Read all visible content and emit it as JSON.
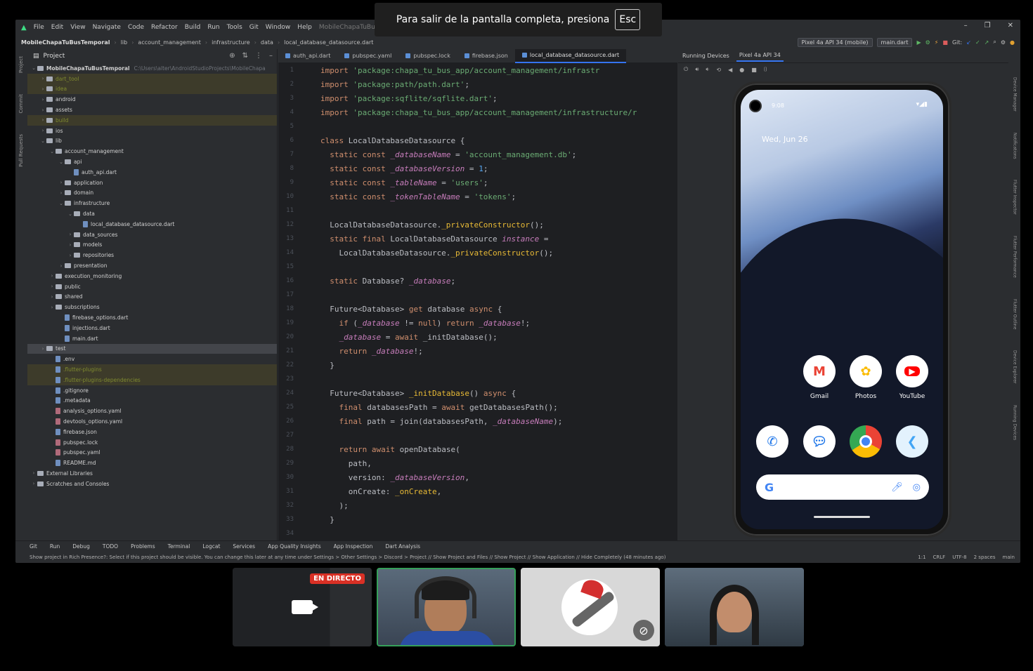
{
  "banner": {
    "text": "Para salir de la pantalla completa, presiona",
    "key": "Esc"
  },
  "menu": [
    "File",
    "Edit",
    "View",
    "Navigate",
    "Code",
    "Refactor",
    "Build",
    "Run",
    "Tools",
    "Git",
    "Window",
    "Help"
  ],
  "window_title": "MobileChapaTuBusTemporal",
  "breadcrumb": [
    "MobileChapaTuBusTemporal",
    "lib",
    "account_management",
    "infrastructure",
    "data",
    "local_database_datasource.dart"
  ],
  "toolbar": {
    "device": "Pixel 4a API 34 (mobile)",
    "run_config": "main.dart",
    "git": "Git:"
  },
  "project_panel": {
    "title": "Project",
    "root": "MobileChapaTuBusTemporal",
    "root_path": "C:\\Users\\alter\\AndroidStudioProjects\\MobileChapa",
    "tree": [
      {
        "label": "dart_tool",
        "level": 1,
        "type": "folder",
        "ignored": true
      },
      {
        "label": "idea",
        "level": 1,
        "type": "folder",
        "ignored": true
      },
      {
        "label": "android",
        "level": 1,
        "type": "folder"
      },
      {
        "label": "assets",
        "level": 1,
        "type": "folder"
      },
      {
        "label": "build",
        "level": 1,
        "type": "folder",
        "ignored": true
      },
      {
        "label": "ios",
        "level": 1,
        "type": "folder"
      },
      {
        "label": "lib",
        "level": 1,
        "type": "folder",
        "open": true
      },
      {
        "label": "account_management",
        "level": 2,
        "type": "folder",
        "open": true
      },
      {
        "label": "api",
        "level": 3,
        "type": "folder",
        "open": true
      },
      {
        "label": "auth_api.dart",
        "level": 4,
        "type": "file"
      },
      {
        "label": "application",
        "level": 3,
        "type": "folder"
      },
      {
        "label": "domain",
        "level": 3,
        "type": "folder"
      },
      {
        "label": "infrastructure",
        "level": 3,
        "type": "folder",
        "open": true
      },
      {
        "label": "data",
        "level": 4,
        "type": "folder",
        "open": true
      },
      {
        "label": "local_database_datasource.dart",
        "level": 5,
        "type": "file"
      },
      {
        "label": "data_sources",
        "level": 4,
        "type": "folder"
      },
      {
        "label": "models",
        "level": 4,
        "type": "folder"
      },
      {
        "label": "repositories",
        "level": 4,
        "type": "folder"
      },
      {
        "label": "presentation",
        "level": 3,
        "type": "folder"
      },
      {
        "label": "execution_monitoring",
        "level": 2,
        "type": "folder"
      },
      {
        "label": "public",
        "level": 2,
        "type": "folder"
      },
      {
        "label": "shared",
        "level": 2,
        "type": "folder"
      },
      {
        "label": "subscriptions",
        "level": 2,
        "type": "folder"
      },
      {
        "label": "firebase_options.dart",
        "level": 3,
        "type": "file"
      },
      {
        "label": "injections.dart",
        "level": 3,
        "type": "file"
      },
      {
        "label": "main.dart",
        "level": 3,
        "type": "file"
      },
      {
        "label": "test",
        "level": 1,
        "type": "folder",
        "selected": true
      },
      {
        "label": ".env",
        "level": 2,
        "type": "file"
      },
      {
        "label": ".flutter-plugins",
        "level": 2,
        "type": "file",
        "ignored": true
      },
      {
        "label": ".flutter-plugins-dependencies",
        "level": 2,
        "type": "file",
        "ignored": true
      },
      {
        "label": ".gitignore",
        "level": 2,
        "type": "file"
      },
      {
        "label": ".metadata",
        "level": 2,
        "type": "file"
      },
      {
        "label": "analysis_options.yaml",
        "level": 2,
        "type": "file",
        "yml": true
      },
      {
        "label": "devtools_options.yaml",
        "level": 2,
        "type": "file",
        "yml": true
      },
      {
        "label": "firebase.json",
        "level": 2,
        "type": "file"
      },
      {
        "label": "pubspec.lock",
        "level": 2,
        "type": "file",
        "yml": true
      },
      {
        "label": "pubspec.yaml",
        "level": 2,
        "type": "file",
        "yml": true
      },
      {
        "label": "README.md",
        "level": 2,
        "type": "file"
      },
      {
        "label": "External Libraries",
        "level": 0,
        "type": "folder"
      },
      {
        "label": "Scratches and Consoles",
        "level": 0,
        "type": "folder"
      }
    ]
  },
  "editor_tabs": [
    "auth_api.dart",
    "pubspec.yaml",
    "pubspec.lock",
    "firebase.json",
    "local_database_datasource.dart"
  ],
  "code_lines": [
    [
      [
        "kw",
        "import "
      ],
      [
        "str",
        "'package:chapa_tu_bus_app/account_management/infrastr"
      ]
    ],
    [
      [
        "kw",
        "import "
      ],
      [
        "str",
        "'package:path/path.dart'"
      ],
      [
        "plain",
        ";"
      ]
    ],
    [
      [
        "kw",
        "import "
      ],
      [
        "str",
        "'package:sqflite/sqflite.dart'"
      ],
      [
        "plain",
        ";"
      ]
    ],
    [
      [
        "kw",
        "import "
      ],
      [
        "str",
        "'package:chapa_tu_bus_app/account_management/infrastructure/r"
      ]
    ],
    [],
    [
      [
        "kw",
        "class "
      ],
      [
        "cls",
        "LocalDatabaseDatasource {"
      ]
    ],
    [
      [
        "plain",
        "  "
      ],
      [
        "kw",
        "static const "
      ],
      [
        "fld",
        "_databaseName"
      ],
      [
        "plain",
        " = "
      ],
      [
        "str",
        "'account_management.db'"
      ],
      [
        "plain",
        ";"
      ]
    ],
    [
      [
        "plain",
        "  "
      ],
      [
        "kw",
        "static const "
      ],
      [
        "fld",
        "_databaseVersion"
      ],
      [
        "plain",
        " = "
      ],
      [
        "fn",
        "1"
      ],
      [
        "plain",
        ";"
      ]
    ],
    [
      [
        "plain",
        "  "
      ],
      [
        "kw",
        "static const "
      ],
      [
        "fld",
        "_tableName"
      ],
      [
        "plain",
        " = "
      ],
      [
        "str",
        "'users'"
      ],
      [
        "plain",
        ";"
      ]
    ],
    [
      [
        "plain",
        "  "
      ],
      [
        "kw",
        "static const "
      ],
      [
        "fld",
        "_tokenTableName"
      ],
      [
        "plain",
        " = "
      ],
      [
        "str",
        "'tokens'"
      ],
      [
        "plain",
        ";"
      ]
    ],
    [],
    [
      [
        "plain",
        "  LocalDatabaseDatasource."
      ],
      [
        "fn2",
        "_privateConstructor"
      ],
      [
        "plain",
        "();"
      ]
    ],
    [
      [
        "plain",
        "  "
      ],
      [
        "kw",
        "static final "
      ],
      [
        "plain",
        "LocalDatabaseDatasource "
      ],
      [
        "fld",
        "instance"
      ],
      [
        "plain",
        " ="
      ]
    ],
    [
      [
        "plain",
        "    LocalDatabaseDatasource."
      ],
      [
        "fn2",
        "_privateConstructor"
      ],
      [
        "plain",
        "();"
      ]
    ],
    [],
    [
      [
        "plain",
        "  "
      ],
      [
        "kw",
        "static "
      ],
      [
        "plain",
        "Database? "
      ],
      [
        "fld",
        "_database"
      ],
      [
        "plain",
        ";"
      ]
    ],
    [],
    [
      [
        "plain",
        "  Future<Database> "
      ],
      [
        "kw",
        "get "
      ],
      [
        "plain",
        "database "
      ],
      [
        "kw",
        "async "
      ],
      [
        "plain",
        "{"
      ]
    ],
    [
      [
        "plain",
        "    "
      ],
      [
        "kw",
        "if "
      ],
      [
        "plain",
        "("
      ],
      [
        "fld",
        "_database"
      ],
      [
        "plain",
        " != "
      ],
      [
        "kw",
        "null"
      ],
      [
        "plain",
        ") "
      ],
      [
        "kw",
        "return "
      ],
      [
        "fld",
        "_database"
      ],
      [
        "plain",
        "!;"
      ]
    ],
    [
      [
        "plain",
        "    "
      ],
      [
        "fld",
        "_database"
      ],
      [
        "plain",
        " = "
      ],
      [
        "kw",
        "await "
      ],
      [
        "plain",
        "_initDatabase();"
      ]
    ],
    [
      [
        "plain",
        "    "
      ],
      [
        "kw",
        "return "
      ],
      [
        "fld",
        "_database"
      ],
      [
        "plain",
        "!;"
      ]
    ],
    [
      [
        "plain",
        "  }"
      ]
    ],
    [],
    [
      [
        "plain",
        "  Future<Database> "
      ],
      [
        "fn2",
        "_initDatabase"
      ],
      [
        "plain",
        "() "
      ],
      [
        "kw",
        "async "
      ],
      [
        "plain",
        "{"
      ]
    ],
    [
      [
        "plain",
        "    "
      ],
      [
        "kw",
        "final "
      ],
      [
        "plain",
        "databasesPath = "
      ],
      [
        "kw",
        "await "
      ],
      [
        "plain",
        "getDatabasesPath();"
      ]
    ],
    [
      [
        "plain",
        "    "
      ],
      [
        "kw",
        "final "
      ],
      [
        "plain",
        "path = join(databasesPath, "
      ],
      [
        "fld",
        "_databaseName"
      ],
      [
        "plain",
        ");"
      ]
    ],
    [],
    [
      [
        "plain",
        "    "
      ],
      [
        "kw",
        "return await "
      ],
      [
        "plain",
        "openDatabase("
      ]
    ],
    [
      [
        "plain",
        "      path,"
      ]
    ],
    [
      [
        "plain",
        "      version: "
      ],
      [
        "fld",
        "_databaseVersion"
      ],
      [
        "plain",
        ","
      ]
    ],
    [
      [
        "plain",
        "      onCreate: "
      ],
      [
        "fn2",
        "_onCreate"
      ],
      [
        "plain",
        ","
      ]
    ],
    [
      [
        "plain",
        "    );"
      ]
    ],
    [
      [
        "plain",
        "  }"
      ]
    ],
    []
  ],
  "running_devices": {
    "title": "Running Devices",
    "tab": "Pixel 4a API 34"
  },
  "phone": {
    "time": "9:08",
    "date": "Wed, Jun 26",
    "apps_row1": [
      {
        "label": "Gmail",
        "color": "#ffffff"
      },
      {
        "label": "Photos",
        "color": "#ffffff"
      },
      {
        "label": "YouTube",
        "color": "#ffffff"
      }
    ],
    "apps_row2": [
      "phone",
      "messages",
      "chrome",
      "flutter"
    ]
  },
  "tool_windows": [
    "Git",
    "Run",
    "Debug",
    "TODO",
    "Problems",
    "Terminal",
    "Logcat",
    "Services",
    "App Quality Insights",
    "App Inspection",
    "Dart Analysis"
  ],
  "status": {
    "message": "Show project in Rich Presence?: Select if this project should be visible. You can change this later at any time under Settings > Other Settings > Discord > Project // Show Project and Files // Show Project // Show Application // Hide Completely (48 minutes ago)",
    "pos": "1:1",
    "crlf": "CRLF",
    "encoding": "UTF-8",
    "indent": "2 spaces",
    "branch": "main"
  },
  "meet": {
    "live": "EN DIRECTO"
  }
}
